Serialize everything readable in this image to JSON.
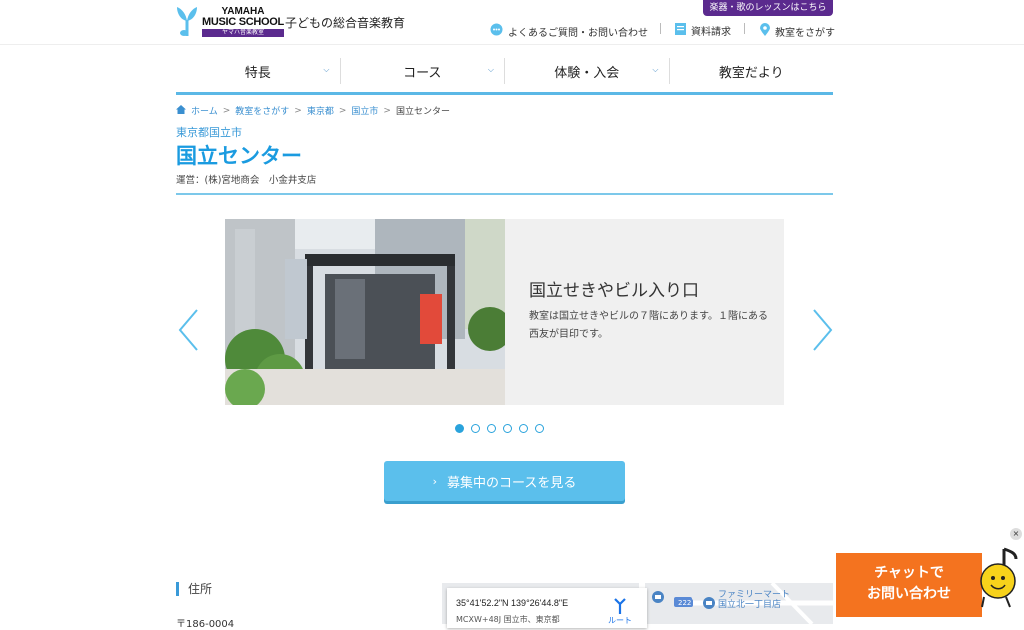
{
  "header": {
    "logo": {
      "line1": "YAMAHA",
      "line2": "MUSIC SCHOOL",
      "line3": "ヤマハ音楽教室"
    },
    "tagline": "子どもの総合音楽教育",
    "lesson_button": "楽器・歌のレッスンはこちら",
    "utility_links": [
      {
        "label": "よくあるご質問・お問い合わせ",
        "icon": "chat-bubble-icon"
      },
      {
        "label": "資料請求",
        "icon": "document-icon"
      },
      {
        "label": "教室をさがす",
        "icon": "location-pin-icon"
      }
    ]
  },
  "nav": [
    {
      "label": "特長",
      "has_dropdown": true
    },
    {
      "label": "コース",
      "has_dropdown": true
    },
    {
      "label": "体験・入会",
      "has_dropdown": true
    },
    {
      "label": "教室だより",
      "has_dropdown": false
    }
  ],
  "breadcrumb": {
    "items": [
      "ホーム",
      "教室をさがす",
      "東京都",
      "国立市"
    ],
    "current": "国立センター",
    "separator": ">"
  },
  "page": {
    "prefecture": "東京都国立市",
    "title": "国立センター",
    "operator": "運営：(株)宮地商会　小金井支店"
  },
  "slider": {
    "title": "国立せきやビル入り口",
    "description": "教室は国立せきやビルの７階にあります。１階にある西友が目印です。",
    "slide_count": 6,
    "active_index": 0
  },
  "cta": {
    "label": "募集中のコースを見る"
  },
  "address": {
    "label": "住所",
    "postal": "〒186-0004"
  },
  "map": {
    "coordinates": "35°41'52.2\"N 139°26'44.8\"E",
    "address": "MCXW+48J 国立市、東京都",
    "route_label": "ルート",
    "poi_line1": "ファミリーマート",
    "poi_line2": "国立北一丁目店",
    "road_number": "222"
  },
  "chat": {
    "line1": "チャットで",
    "line2": "お問い合わせ",
    "close": "×"
  },
  "colors": {
    "brand_purple": "#5b2a8e",
    "accent_blue": "#1a9be0",
    "cta_blue": "#5bbfec",
    "chat_orange": "#f4731f"
  }
}
